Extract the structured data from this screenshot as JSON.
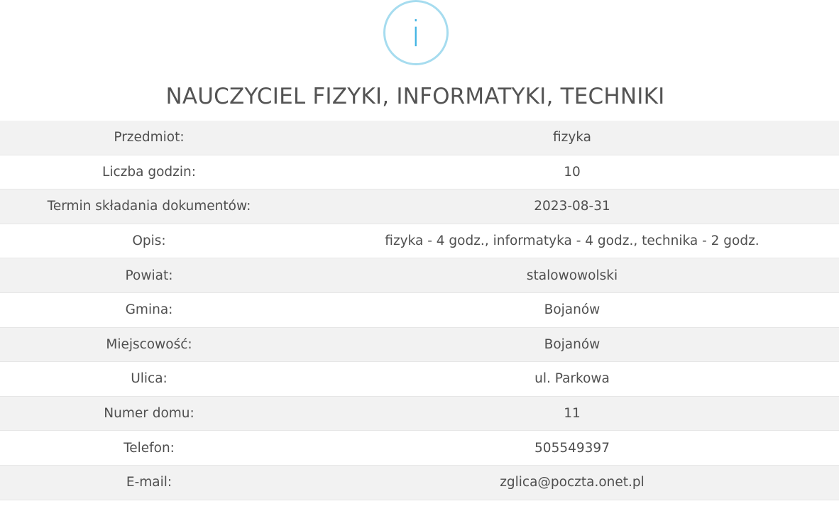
{
  "header": {
    "icon": "info-icon",
    "icon_glyph": "i",
    "icon_color": "#3fb3e3",
    "icon_ring_color": "#a6dcef",
    "title": "NAUCZYCIEL FIZYKI, INFORMATYKI, TECHNIKI"
  },
  "details": {
    "rows": [
      {
        "label": "Przedmiot:",
        "value": "fizyka"
      },
      {
        "label": "Liczba godzin:",
        "value": "10"
      },
      {
        "label": "Termin składania dokumentów:",
        "value": "2023-08-31"
      },
      {
        "label": "Opis:",
        "value": "fizyka - 4 godz., informatyka - 4 godz., technika - 2 godz."
      },
      {
        "label": "Powiat:",
        "value": "stalowowolski"
      },
      {
        "label": "Gmina:",
        "value": "Bojanów"
      },
      {
        "label": "Miejscowość:",
        "value": "Bojanów"
      },
      {
        "label": "Ulica:",
        "value": "ul. Parkowa"
      },
      {
        "label": "Numer domu:",
        "value": "11"
      },
      {
        "label": "Telefon:",
        "value": "505549397"
      },
      {
        "label": "E-mail:",
        "value": "zglica@poczta.onet.pl"
      }
    ]
  }
}
